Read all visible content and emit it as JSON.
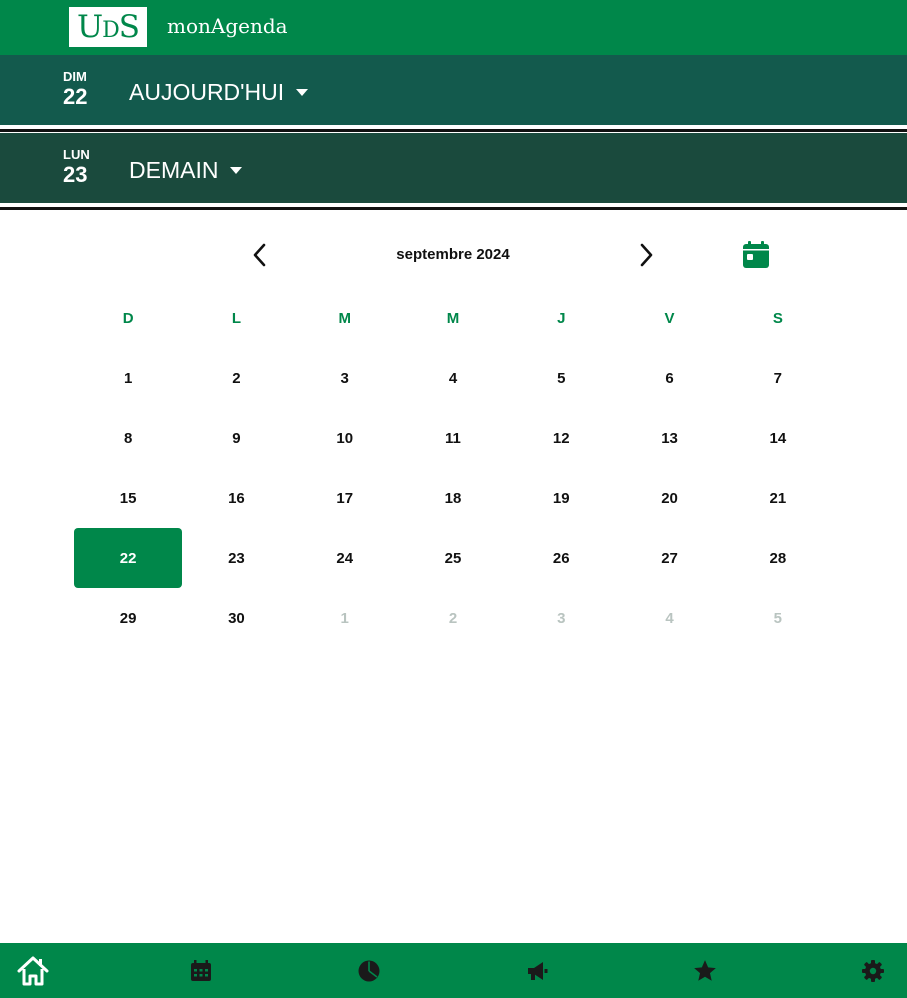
{
  "header": {
    "logo": {
      "u": "U",
      "d": "D",
      "s": "S"
    },
    "app_title": "monAgenda"
  },
  "today": {
    "dow": "DIM",
    "day": "22",
    "label": "AUJOURD'HUI"
  },
  "tomorrow": {
    "dow": "LUN",
    "day": "23",
    "label": "DEMAIN"
  },
  "calendar": {
    "month": "septembre 2024",
    "weekdays": [
      "D",
      "L",
      "M",
      "M",
      "J",
      "V",
      "S"
    ],
    "weeks": [
      [
        "1",
        "2",
        "3",
        "4",
        "5",
        "6",
        "7"
      ],
      [
        "8",
        "9",
        "10",
        "11",
        "12",
        "13",
        "14"
      ],
      [
        "15",
        "16",
        "17",
        "18",
        "19",
        "20",
        "21"
      ],
      [
        "22",
        "23",
        "24",
        "25",
        "26",
        "27",
        "28"
      ],
      [
        "29",
        "30",
        "1",
        "2",
        "3",
        "4",
        "5"
      ]
    ],
    "selected": "22"
  },
  "bottom_tabs": [
    "home-icon",
    "calendar-icon",
    "pie-chart-icon",
    "megaphone-icon",
    "star-icon",
    "gear-icon"
  ],
  "colors": {
    "brand": "#00874a",
    "today_band": "#135a4d",
    "tomorrow_band": "#1a4a3d",
    "muted": "#b9c4c0"
  }
}
